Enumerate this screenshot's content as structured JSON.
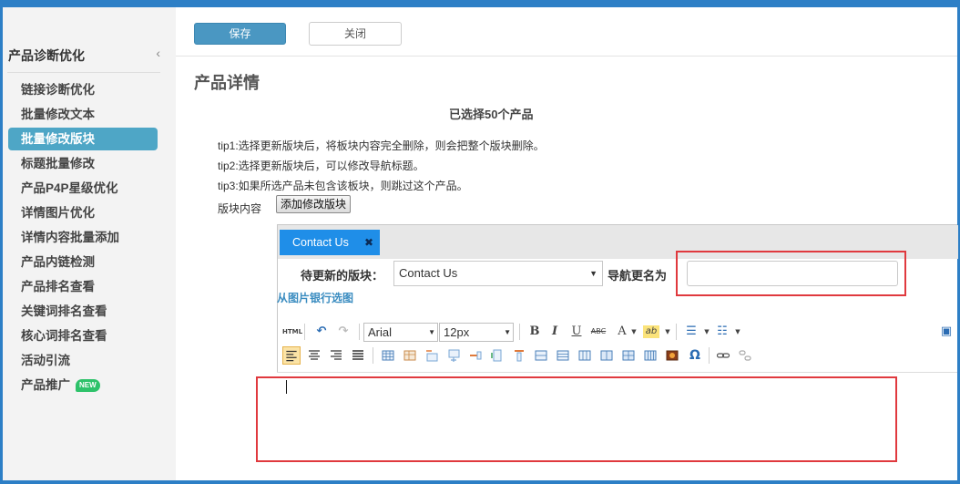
{
  "sidebar": {
    "title": "产品诊断优化",
    "collapse_icon": "‹",
    "items": [
      {
        "label": "链接诊断优化",
        "active": false
      },
      {
        "label": "批量修改文本",
        "active": false
      },
      {
        "label": "批量修改版块",
        "active": true
      },
      {
        "label": "标题批量修改",
        "active": false
      },
      {
        "label": "产品P4P星级优化",
        "active": false
      },
      {
        "label": "详情图片优化",
        "active": false
      },
      {
        "label": "详情内容批量添加",
        "active": false
      },
      {
        "label": "产品内链检测",
        "active": false
      },
      {
        "label": "产品排名查看",
        "active": false
      },
      {
        "label": "关键词排名查看",
        "active": false
      },
      {
        "label": "核心词排名查看",
        "active": false
      },
      {
        "label": "活动引流",
        "active": false
      },
      {
        "label": "产品推广",
        "active": false,
        "badge": "NEW"
      }
    ]
  },
  "topbar": {
    "save_label": "保存",
    "close_label": "关闭"
  },
  "main": {
    "section_title": "产品详情",
    "selected_count": "已选择50个产品",
    "tips": [
      "tip1:选择更新版块后，将板块内容完全删除，则会把整个版块删除。",
      "tip2:选择更新版块后，可以修改导航标题。",
      "tip3:如果所选产品未包含该板块，则跳过这个产品。"
    ],
    "block_label": "版块内容",
    "add_block_label": "添加修改版块"
  },
  "editor": {
    "tab_label": "Contact Us",
    "tab_close": "✖",
    "update_block_label": "待更新的版块：",
    "update_block_value": "Contact Us",
    "rename_nav_label": "导航更名为",
    "rename_nav_value": "",
    "image_bank_link": "从图片银行选图",
    "toolbar": {
      "html_label": "HTML",
      "font_family": "Arial",
      "font_size": "12px",
      "bold": "B",
      "italic": "I",
      "underline": "U",
      "strike": "ABC",
      "font_color": "A",
      "highlight": "ab",
      "special_char": "Ω"
    },
    "content": ""
  },
  "colors": {
    "frame": "#2d7fc6",
    "active_nav": "#4ea6c6",
    "save_button": "#4a97c2",
    "tab_active": "#1f8ee8",
    "highlight_box": "#e0393e",
    "link": "#3a8cc0",
    "new_badge": "#2ec26a"
  }
}
